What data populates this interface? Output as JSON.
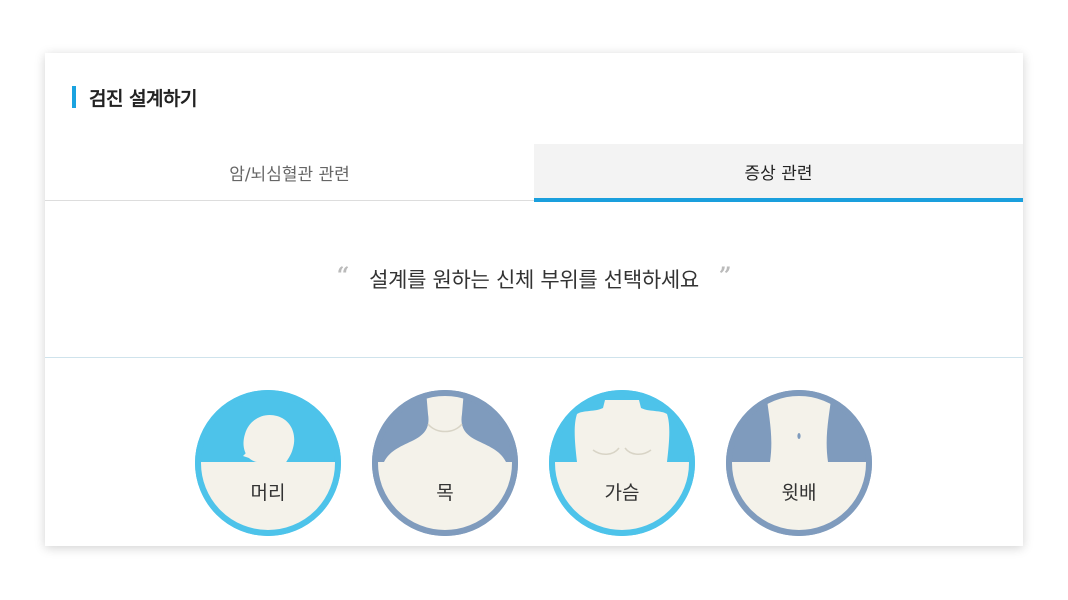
{
  "section": {
    "title": "검진 설계하기"
  },
  "tabs": [
    {
      "label": "암/뇌심혈관 관련",
      "active": false
    },
    {
      "label": "증상 관련",
      "active": true
    }
  ],
  "prompt": {
    "open_quote": "“",
    "text": "설계를 원하는 신체 부위를 선택하세요",
    "close_quote": "”"
  },
  "body_parts": [
    {
      "label": "머리",
      "icon": "head-icon",
      "color": "#4dc3ea"
    },
    {
      "label": "목",
      "icon": "neck-icon",
      "color": "#7f9bbd"
    },
    {
      "label": "가슴",
      "icon": "chest-icon",
      "color": "#4dc3ea"
    },
    {
      "label": "윗배",
      "icon": "upper-abdomen-icon",
      "color": "#7f9bbd"
    }
  ],
  "colors": {
    "accent": "#1aa3e0",
    "circle_blue": "#4dc3ea",
    "circle_slate": "#7f9bbd",
    "circle_fill": "#f4f2ea"
  }
}
